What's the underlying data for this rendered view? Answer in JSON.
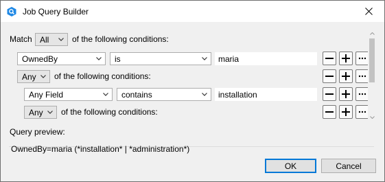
{
  "window": {
    "title": "Job Query Builder",
    "icon": "app-icon",
    "close_icon": "close-icon"
  },
  "root": {
    "prefix": "Match",
    "quantifier": "All",
    "suffix": "of the following conditions:"
  },
  "conditions": [
    {
      "field": "OwnedBy",
      "operator": "is",
      "value": "maria"
    }
  ],
  "group1": {
    "quantifier": "Any",
    "suffix": "of the following conditions:",
    "condition": {
      "field": "Any Field",
      "operator": "contains",
      "value": "installation"
    }
  },
  "group2": {
    "quantifier": "Any",
    "suffix": "of the following conditions:"
  },
  "row_buttons": {
    "remove_icon": "minus-icon",
    "add_icon": "plus-icon",
    "more_icon": "ellipsis-icon"
  },
  "preview": {
    "label": "Query preview:",
    "text": "OwnedBy=maria (*installation* | *administration*)"
  },
  "buttons": {
    "ok": "OK",
    "cancel": "Cancel"
  },
  "colors": {
    "accent": "#0078d7",
    "icon_blue": "#1e88e5"
  }
}
